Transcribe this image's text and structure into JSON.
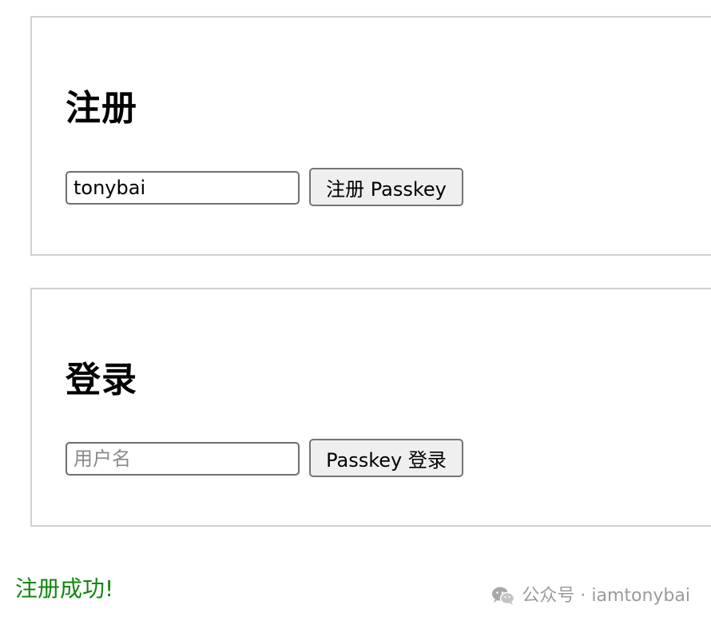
{
  "register": {
    "title": "注册",
    "username_value": "tonybai",
    "button_label": "注册 Passkey"
  },
  "login": {
    "title": "登录",
    "username_placeholder": "用户名",
    "button_label": "Passkey 登录"
  },
  "status": {
    "message": "注册成功!",
    "color": "#118611"
  },
  "watermark": {
    "icon": "wechat-icon",
    "text": "公众号 · iamtonybai"
  }
}
